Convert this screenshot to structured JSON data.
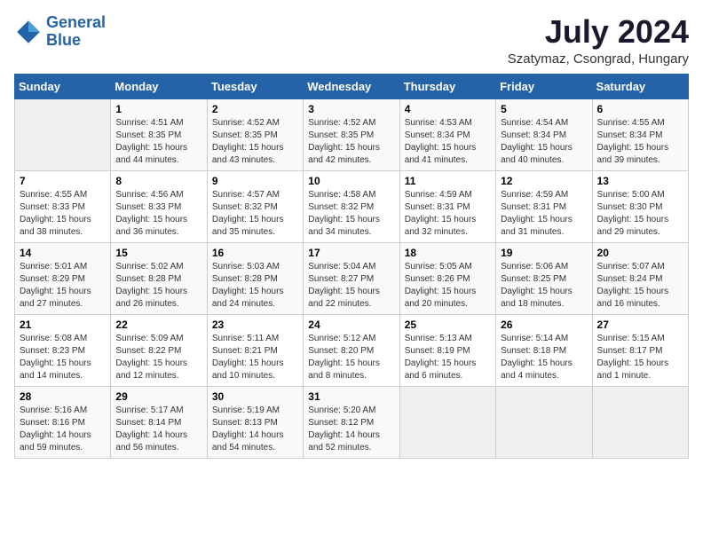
{
  "logo": {
    "line1": "General",
    "line2": "Blue"
  },
  "title": "July 2024",
  "location": "Szatymaz, Csongrad, Hungary",
  "days_header": [
    "Sunday",
    "Monday",
    "Tuesday",
    "Wednesday",
    "Thursday",
    "Friday",
    "Saturday"
  ],
  "weeks": [
    [
      {
        "num": "",
        "info": ""
      },
      {
        "num": "1",
        "info": "Sunrise: 4:51 AM\nSunset: 8:35 PM\nDaylight: 15 hours\nand 44 minutes."
      },
      {
        "num": "2",
        "info": "Sunrise: 4:52 AM\nSunset: 8:35 PM\nDaylight: 15 hours\nand 43 minutes."
      },
      {
        "num": "3",
        "info": "Sunrise: 4:52 AM\nSunset: 8:35 PM\nDaylight: 15 hours\nand 42 minutes."
      },
      {
        "num": "4",
        "info": "Sunrise: 4:53 AM\nSunset: 8:34 PM\nDaylight: 15 hours\nand 41 minutes."
      },
      {
        "num": "5",
        "info": "Sunrise: 4:54 AM\nSunset: 8:34 PM\nDaylight: 15 hours\nand 40 minutes."
      },
      {
        "num": "6",
        "info": "Sunrise: 4:55 AM\nSunset: 8:34 PM\nDaylight: 15 hours\nand 39 minutes."
      }
    ],
    [
      {
        "num": "7",
        "info": "Sunrise: 4:55 AM\nSunset: 8:33 PM\nDaylight: 15 hours\nand 38 minutes."
      },
      {
        "num": "8",
        "info": "Sunrise: 4:56 AM\nSunset: 8:33 PM\nDaylight: 15 hours\nand 36 minutes."
      },
      {
        "num": "9",
        "info": "Sunrise: 4:57 AM\nSunset: 8:32 PM\nDaylight: 15 hours\nand 35 minutes."
      },
      {
        "num": "10",
        "info": "Sunrise: 4:58 AM\nSunset: 8:32 PM\nDaylight: 15 hours\nand 34 minutes."
      },
      {
        "num": "11",
        "info": "Sunrise: 4:59 AM\nSunset: 8:31 PM\nDaylight: 15 hours\nand 32 minutes."
      },
      {
        "num": "12",
        "info": "Sunrise: 4:59 AM\nSunset: 8:31 PM\nDaylight: 15 hours\nand 31 minutes."
      },
      {
        "num": "13",
        "info": "Sunrise: 5:00 AM\nSunset: 8:30 PM\nDaylight: 15 hours\nand 29 minutes."
      }
    ],
    [
      {
        "num": "14",
        "info": "Sunrise: 5:01 AM\nSunset: 8:29 PM\nDaylight: 15 hours\nand 27 minutes."
      },
      {
        "num": "15",
        "info": "Sunrise: 5:02 AM\nSunset: 8:28 PM\nDaylight: 15 hours\nand 26 minutes."
      },
      {
        "num": "16",
        "info": "Sunrise: 5:03 AM\nSunset: 8:28 PM\nDaylight: 15 hours\nand 24 minutes."
      },
      {
        "num": "17",
        "info": "Sunrise: 5:04 AM\nSunset: 8:27 PM\nDaylight: 15 hours\nand 22 minutes."
      },
      {
        "num": "18",
        "info": "Sunrise: 5:05 AM\nSunset: 8:26 PM\nDaylight: 15 hours\nand 20 minutes."
      },
      {
        "num": "19",
        "info": "Sunrise: 5:06 AM\nSunset: 8:25 PM\nDaylight: 15 hours\nand 18 minutes."
      },
      {
        "num": "20",
        "info": "Sunrise: 5:07 AM\nSunset: 8:24 PM\nDaylight: 15 hours\nand 16 minutes."
      }
    ],
    [
      {
        "num": "21",
        "info": "Sunrise: 5:08 AM\nSunset: 8:23 PM\nDaylight: 15 hours\nand 14 minutes."
      },
      {
        "num": "22",
        "info": "Sunrise: 5:09 AM\nSunset: 8:22 PM\nDaylight: 15 hours\nand 12 minutes."
      },
      {
        "num": "23",
        "info": "Sunrise: 5:11 AM\nSunset: 8:21 PM\nDaylight: 15 hours\nand 10 minutes."
      },
      {
        "num": "24",
        "info": "Sunrise: 5:12 AM\nSunset: 8:20 PM\nDaylight: 15 hours\nand 8 minutes."
      },
      {
        "num": "25",
        "info": "Sunrise: 5:13 AM\nSunset: 8:19 PM\nDaylight: 15 hours\nand 6 minutes."
      },
      {
        "num": "26",
        "info": "Sunrise: 5:14 AM\nSunset: 8:18 PM\nDaylight: 15 hours\nand 4 minutes."
      },
      {
        "num": "27",
        "info": "Sunrise: 5:15 AM\nSunset: 8:17 PM\nDaylight: 15 hours\nand 1 minute."
      }
    ],
    [
      {
        "num": "28",
        "info": "Sunrise: 5:16 AM\nSunset: 8:16 PM\nDaylight: 14 hours\nand 59 minutes."
      },
      {
        "num": "29",
        "info": "Sunrise: 5:17 AM\nSunset: 8:14 PM\nDaylight: 14 hours\nand 56 minutes."
      },
      {
        "num": "30",
        "info": "Sunrise: 5:19 AM\nSunset: 8:13 PM\nDaylight: 14 hours\nand 54 minutes."
      },
      {
        "num": "31",
        "info": "Sunrise: 5:20 AM\nSunset: 8:12 PM\nDaylight: 14 hours\nand 52 minutes."
      },
      {
        "num": "",
        "info": ""
      },
      {
        "num": "",
        "info": ""
      },
      {
        "num": "",
        "info": ""
      }
    ]
  ]
}
